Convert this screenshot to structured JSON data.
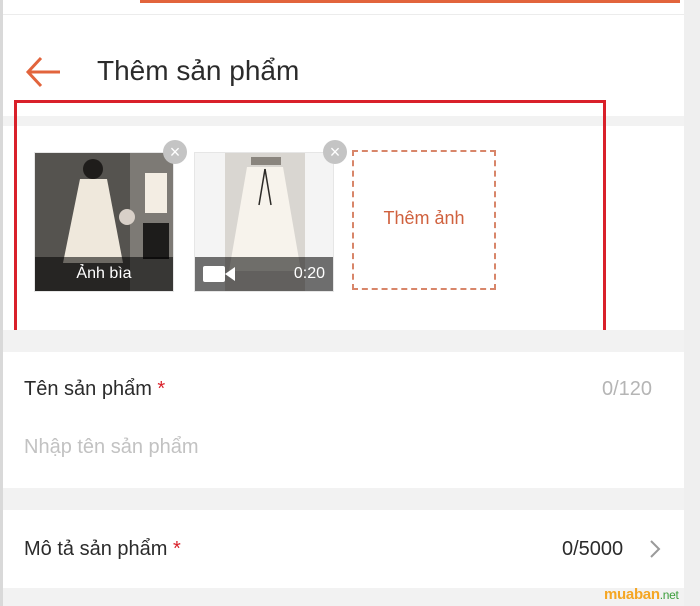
{
  "header": {
    "title": "Thêm sản phẩm",
    "back_icon": "arrow-left-icon"
  },
  "media": {
    "items": [
      {
        "type": "image",
        "label": "Ảnh bìa"
      },
      {
        "type": "video",
        "duration": "0:20"
      }
    ],
    "add_label": "Thêm ảnh"
  },
  "product_name": {
    "label": "Tên sản phẩm",
    "required_mark": "*",
    "counter": "0/120",
    "placeholder": "Nhập tên sản phẩm"
  },
  "product_description": {
    "label": "Mô tả sản phẩm",
    "required_mark": "*",
    "counter": "0/5000"
  },
  "watermark": {
    "main": "muaban",
    "suffix": ".net"
  },
  "colors": {
    "accent": "#e2643c",
    "highlight": "#d9202a",
    "required": "#d9202a"
  }
}
